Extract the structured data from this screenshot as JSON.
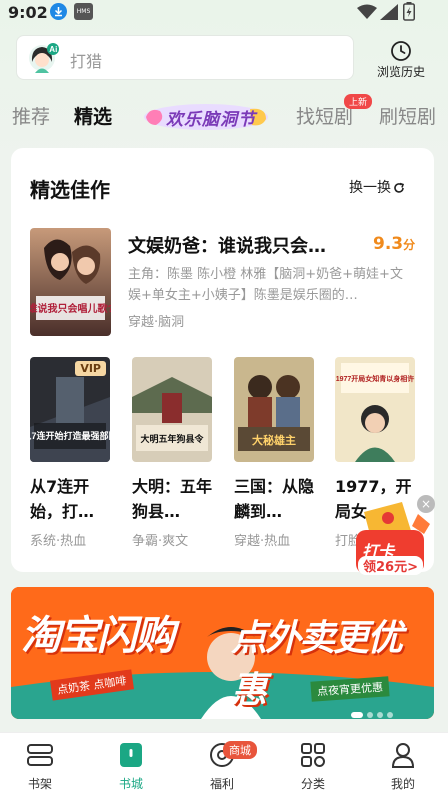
{
  "status_bar": {
    "time": "9:02",
    "hms_label": "HMS"
  },
  "search": {
    "placeholder": "打猎",
    "ai_label": "Ai"
  },
  "history": {
    "label": "浏览历史"
  },
  "tabs": [
    {
      "label": "推荐"
    },
    {
      "label": "精选"
    },
    {
      "label": "欢乐脑洞节"
    },
    {
      "label": "找短剧",
      "badge": "上新"
    },
    {
      "label": "刷短剧"
    }
  ],
  "section": {
    "title": "精选佳作",
    "refresh_label": "换一换"
  },
  "feature": {
    "title": "文娱奶爸：谁说我只会…",
    "score": "9.3",
    "score_unit": "分",
    "description": "主角：陈墨 陈小橙 林雅【脑洞+奶爸+萌娃+文娱+单女主+小姨子】陈墨是娱乐圈的…",
    "tags": "穿越·脑洞",
    "cover_text": "谁说我只会唱儿歌?"
  },
  "books": [
    {
      "title": "从7连开始，打…",
      "tags": "系统·热血",
      "cover_text": "从7连开始打造最强部队",
      "vip": "VIP"
    },
    {
      "title": "大明：五年狗县…",
      "tags": "争霸·爽文",
      "cover_text": "大明五年狗县令"
    },
    {
      "title": "三国：从隐麟到…",
      "tags": "穿越·热血",
      "cover_text": "大秘雄主"
    },
    {
      "title": "1977，开局女…",
      "tags": "打脸·",
      "cover_text": "1977开局女知青以身相许"
    }
  ],
  "checkin": {
    "title": "打卡",
    "subtitle": "领26元>",
    "close": "×"
  },
  "banner": {
    "brand": "淘宝闪购",
    "slogan": "点外卖更优惠",
    "tag_left": "点奶茶 点咖啡",
    "tag_right": "点夜宵更优惠"
  },
  "bottom_nav": [
    {
      "label": "书架"
    },
    {
      "label": "书城"
    },
    {
      "label": "福利",
      "badge": "商城"
    },
    {
      "label": "分类"
    },
    {
      "label": "我的"
    }
  ],
  "colors": {
    "accent": "#1ba784",
    "score": "#f08a1c",
    "badge_red": "#f04848",
    "banner_orange": "#ff6a1a"
  }
}
